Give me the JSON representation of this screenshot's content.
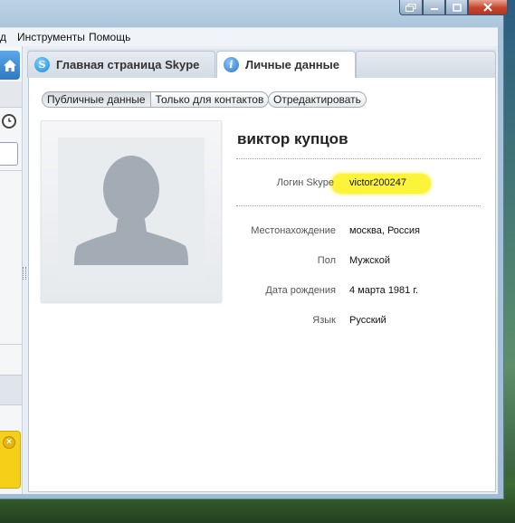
{
  "menubar": {
    "items": [
      "д",
      "Инструменты",
      "Помощь"
    ]
  },
  "tabs": {
    "home": "Главная страница Skype",
    "profile": "Личные данные"
  },
  "subtabs": {
    "public": "Публичные данные",
    "contacts_only": "Только для контактов",
    "edit": "Отредактировать"
  },
  "profile": {
    "name": "виктор купцов",
    "skype_login_label": "Логин Skype",
    "skype_login": "victor200247",
    "fields": [
      {
        "label": "Местонахождение",
        "value": "москва, Россия"
      },
      {
        "label": "Пол",
        "value": "Мужской"
      },
      {
        "label": "Дата рождения",
        "value": "4 марта 1981 г."
      },
      {
        "label": "Язык",
        "value": "Русский"
      }
    ]
  },
  "icons": {
    "home": "home-icon",
    "recent": "clock-icon",
    "skype": "skype-icon",
    "info": "info-icon",
    "close": "close-icon"
  },
  "colors": {
    "highlight": "#fbf43a",
    "accent": "#2f79c3",
    "notification": "#f5cf18"
  }
}
